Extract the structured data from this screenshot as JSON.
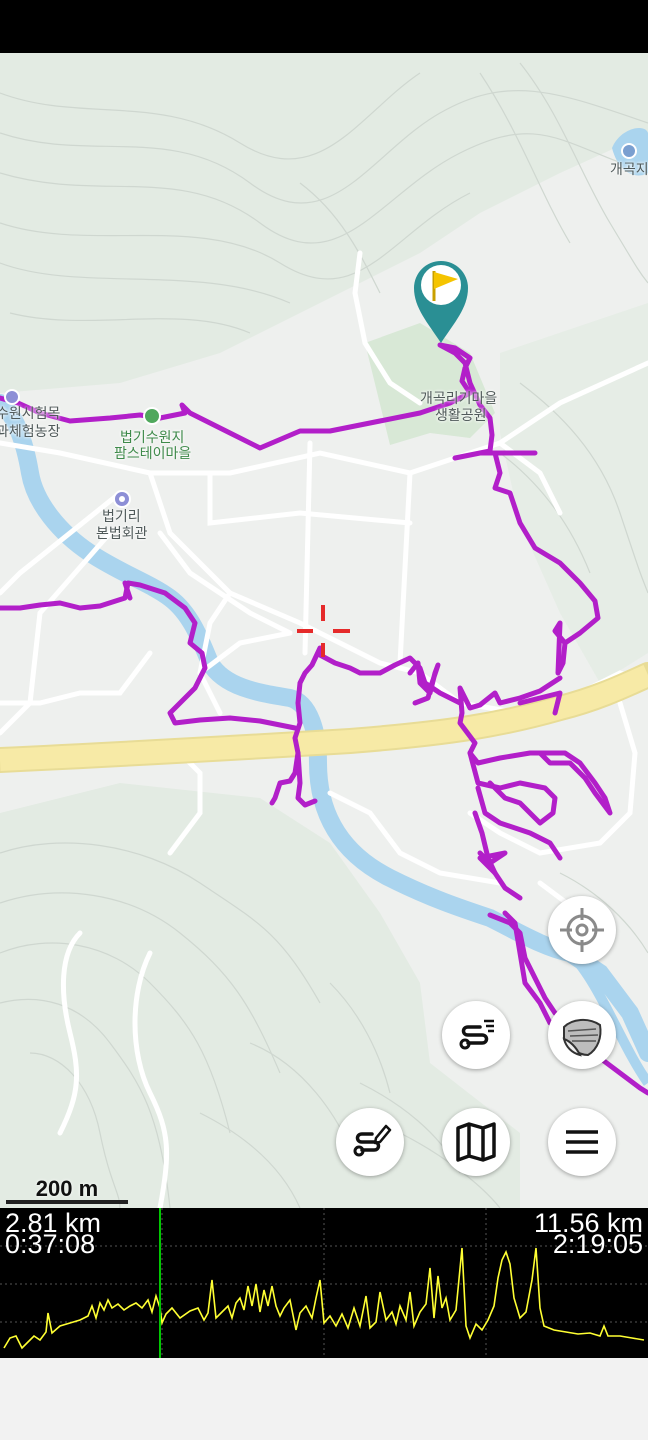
{
  "map": {
    "places": [
      {
        "id": "gaegokji",
        "text": "개곡지"
      },
      {
        "id": "saenghwal1",
        "text": "개곡리기마을"
      },
      {
        "id": "saenghwal2",
        "text": "생활공원"
      },
      {
        "id": "farm1",
        "text": "수원시험목"
      },
      {
        "id": "farm2",
        "text": "과체험농장"
      },
      {
        "id": "beobgi1",
        "text": "법기수원지"
      },
      {
        "id": "beobgi2",
        "text": "팜스테이마을"
      },
      {
        "id": "hall1",
        "text": "법기리"
      },
      {
        "id": "hall2",
        "text": "본법회관"
      }
    ],
    "scale_label": "200 m",
    "track_color": "#b21fc9",
    "waypoint_color": "#2a8f94"
  },
  "buttons": {
    "locate": "crosshair-icon",
    "layers": "layers-icon",
    "route": "route-list-icon",
    "edit_route": "route-edit-icon",
    "map": "map-icon",
    "menu": "menu-icon"
  },
  "profile": {
    "left_distance": "2.81 km",
    "left_time": "0:37:08",
    "right_distance": "11.56 km",
    "right_time": "2:19:05",
    "line_color": "#ffff33",
    "cursor_color": "#00c800"
  }
}
